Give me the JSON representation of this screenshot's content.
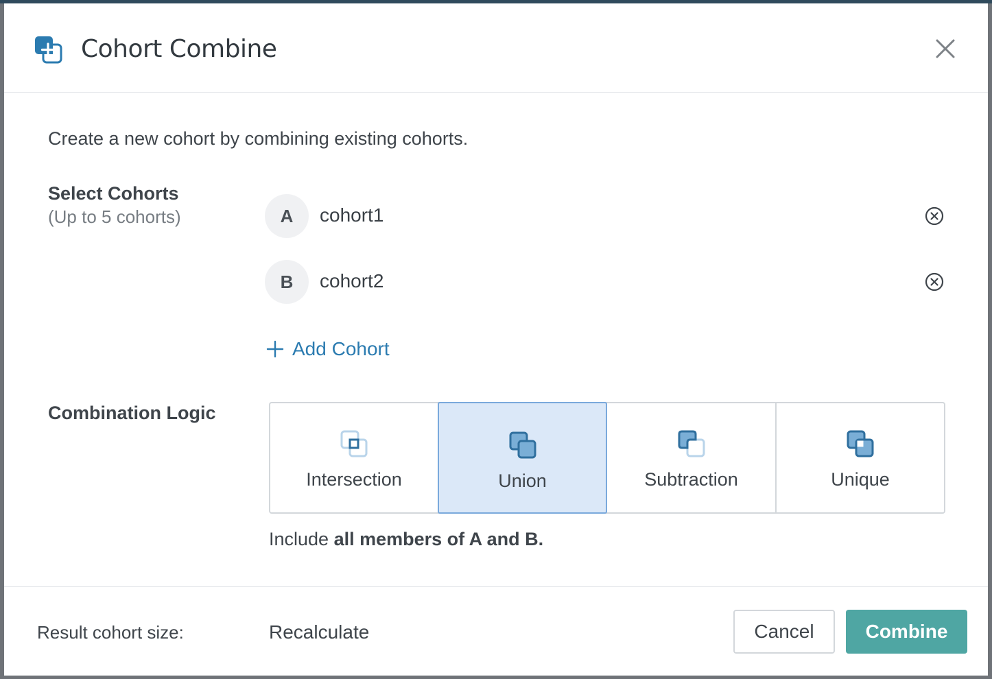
{
  "dialog": {
    "title": "Cohort Combine",
    "description": "Create a new cohort by combining existing cohorts."
  },
  "select_cohorts": {
    "label": "Select Cohorts",
    "sublabel": "(Up to 5 cohorts)",
    "items": [
      {
        "letter": "A",
        "name": "cohort1"
      },
      {
        "letter": "B",
        "name": "cohort2"
      }
    ],
    "add_label": "Add Cohort"
  },
  "combination_logic": {
    "label": "Combination Logic",
    "options": [
      {
        "label": "Intersection",
        "selected": false
      },
      {
        "label": "Union",
        "selected": true
      },
      {
        "label": "Subtraction",
        "selected": false
      },
      {
        "label": "Unique",
        "selected": false
      }
    ],
    "description_prefix": "Include ",
    "description_bold": "all members of A and B."
  },
  "footer": {
    "result_label": "Result cohort size:",
    "recalculate_label": "Recalculate",
    "cancel_label": "Cancel",
    "combine_label": "Combine"
  },
  "colors": {
    "accent_blue": "#2b7bb0",
    "combine_button": "#4fa6a3",
    "selected_bg": "#dbe8f8",
    "selected_border": "#7aa9dc"
  }
}
